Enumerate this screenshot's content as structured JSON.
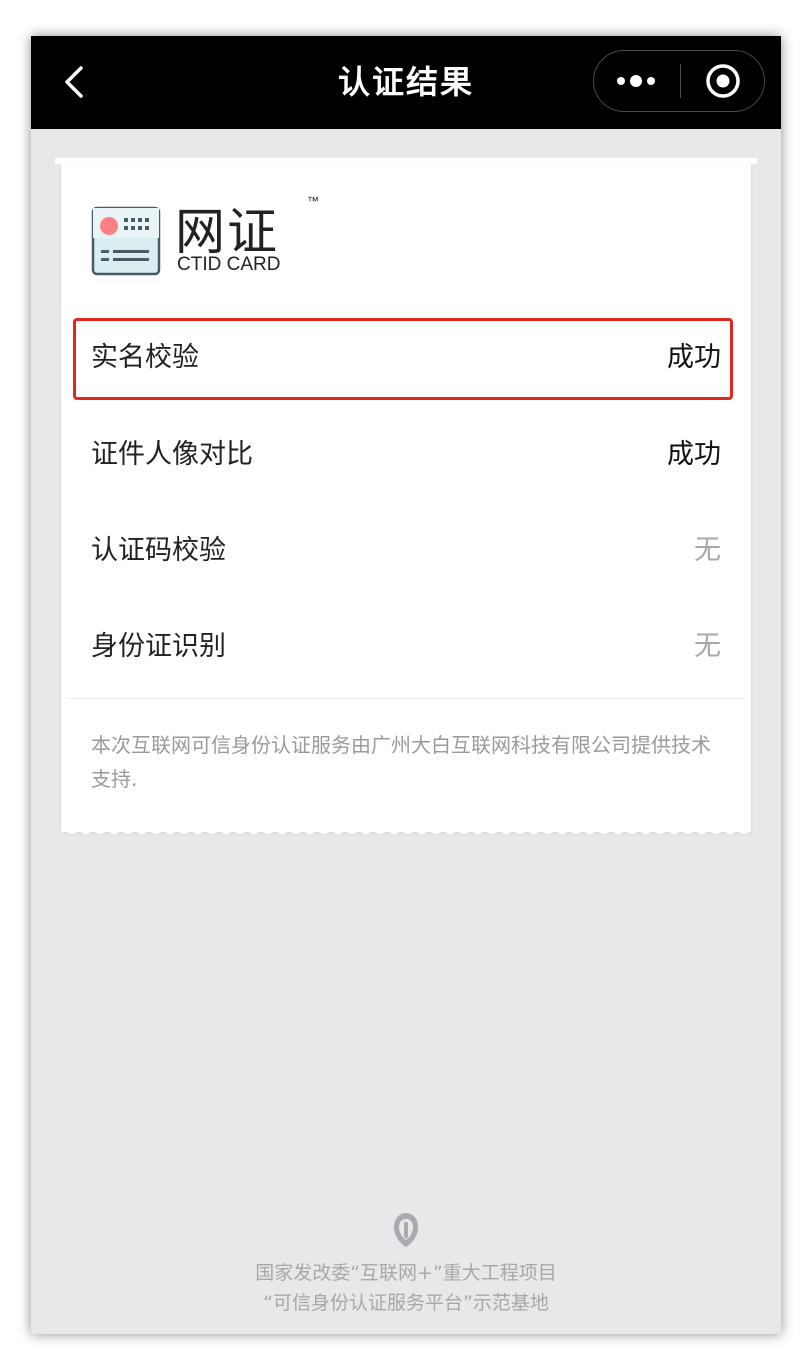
{
  "header": {
    "title": "认证结果",
    "back_icon": "chevron-left-icon",
    "more_icon": "more-dots-icon",
    "close_icon": "target-close-icon"
  },
  "logo": {
    "name_cn": "网证",
    "tm": "™",
    "name_en": "CTID CARD"
  },
  "results": [
    {
      "label": "实名校验",
      "value": "成功",
      "status": "ok",
      "highlighted": true
    },
    {
      "label": "证件人像对比",
      "value": "成功",
      "status": "ok",
      "highlighted": false
    },
    {
      "label": "认证码校验",
      "value": "无",
      "status": "none",
      "highlighted": false
    },
    {
      "label": "身份证识别",
      "value": "无",
      "status": "none",
      "highlighted": false
    }
  ],
  "note": "本次互联网可信身份认证服务由广州大白互联网科技有限公司提供技术支持.",
  "footer": {
    "line1": "国家发改委“互联网+”重大工程项目",
    "line2": "“可信身份认证服务平台”示范基地"
  },
  "colors": {
    "titlebar": "#000000",
    "background": "#e8e8eb",
    "highlight_border": "#e0261e",
    "value_none": "#a8a8a8"
  }
}
